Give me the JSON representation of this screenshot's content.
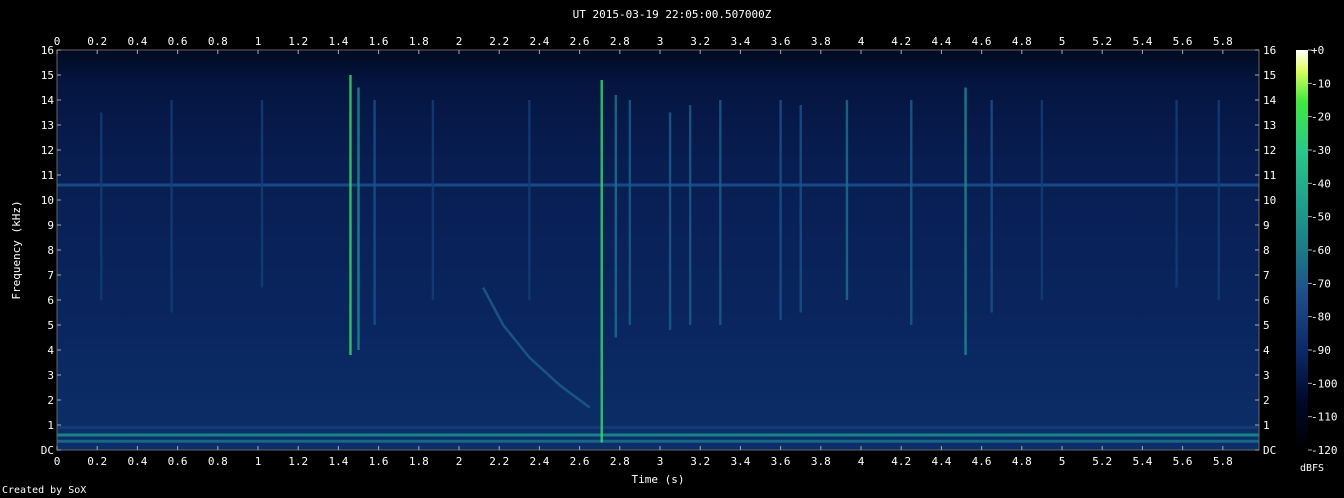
{
  "header": {
    "title": "UT 2015-03-19 22:05:00.507000Z"
  },
  "footer": {
    "credit": "Created by SoX"
  },
  "colorbar": {
    "unit": "dBFS",
    "ticks": [
      "+0",
      "-10",
      "-20",
      "-30",
      "-40",
      "-50",
      "-60",
      "-70",
      "-80",
      "-90",
      "-100",
      "-110",
      "-120"
    ]
  },
  "colors": {
    "background": "#000000",
    "low": "#000828",
    "mid": "#1f4a8a",
    "high": "#29c98a",
    "peak": "#ffffff"
  },
  "chart_data": {
    "type": "heatmap",
    "xlabel": "Time (s)",
    "ylabel": "Frequency (kHz)",
    "xlim": [
      0,
      5.98
    ],
    "ylim": [
      0,
      16
    ],
    "zlim": [
      -120,
      0
    ],
    "x_ticks": [
      "0",
      "0.2",
      "0.4",
      "0.6",
      "0.8",
      "1",
      "1.2",
      "1.4",
      "1.6",
      "1.8",
      "2",
      "2.2",
      "2.4",
      "2.6",
      "2.8",
      "3",
      "3.2",
      "3.4",
      "3.6",
      "3.8",
      "4",
      "4.2",
      "4.4",
      "4.6",
      "4.8",
      "5",
      "5.2",
      "5.4",
      "5.6",
      "5.8"
    ],
    "y_ticks": [
      "DC",
      "1",
      "2",
      "3",
      "4",
      "5",
      "6",
      "7",
      "8",
      "9",
      "10",
      "11",
      "12",
      "13",
      "14",
      "15",
      "16"
    ],
    "background_level_db": -100,
    "tonal_lines": [
      {
        "freq_khz": 10.6,
        "level_db": -80
      },
      {
        "freq_khz": 0.35,
        "level_db": -75
      },
      {
        "freq_khz": 0.6,
        "level_db": -70
      },
      {
        "freq_khz": 0.9,
        "level_db": -85
      }
    ],
    "impulses": [
      {
        "t": 1.46,
        "fmin": 3.8,
        "fmax": 15.0,
        "level_db": -55
      },
      {
        "t": 1.5,
        "fmin": 4.0,
        "fmax": 14.5,
        "level_db": -70
      },
      {
        "t": 1.58,
        "fmin": 5.0,
        "fmax": 14.0,
        "level_db": -80
      },
      {
        "t": 2.71,
        "fmin": 0.3,
        "fmax": 14.8,
        "level_db": -55
      },
      {
        "t": 2.78,
        "fmin": 4.5,
        "fmax": 14.2,
        "level_db": -75
      },
      {
        "t": 2.85,
        "fmin": 5.0,
        "fmax": 14.0,
        "level_db": -78
      },
      {
        "t": 3.05,
        "fmin": 4.8,
        "fmax": 13.5,
        "level_db": -78
      },
      {
        "t": 3.15,
        "fmin": 5.0,
        "fmax": 13.8,
        "level_db": -78
      },
      {
        "t": 3.3,
        "fmin": 5.0,
        "fmax": 14.0,
        "level_db": -78
      },
      {
        "t": 3.6,
        "fmin": 5.2,
        "fmax": 14.0,
        "level_db": -80
      },
      {
        "t": 3.7,
        "fmin": 5.5,
        "fmax": 13.8,
        "level_db": -80
      },
      {
        "t": 3.93,
        "fmin": 6.0,
        "fmax": 14.0,
        "level_db": -75
      },
      {
        "t": 4.25,
        "fmin": 5.0,
        "fmax": 14.0,
        "level_db": -78
      },
      {
        "t": 4.52,
        "fmin": 3.8,
        "fmax": 14.5,
        "level_db": -70
      },
      {
        "t": 4.65,
        "fmin": 5.5,
        "fmax": 14.0,
        "level_db": -80
      },
      {
        "t": 0.22,
        "fmin": 6.0,
        "fmax": 13.5,
        "level_db": -85
      },
      {
        "t": 0.57,
        "fmin": 5.5,
        "fmax": 14.0,
        "level_db": -85
      },
      {
        "t": 1.02,
        "fmin": 6.5,
        "fmax": 14.0,
        "level_db": -85
      },
      {
        "t": 1.87,
        "fmin": 6.0,
        "fmax": 14.0,
        "level_db": -85
      },
      {
        "t": 2.35,
        "fmin": 6.0,
        "fmax": 14.0,
        "level_db": -85
      },
      {
        "t": 4.9,
        "fmin": 6.0,
        "fmax": 14.0,
        "level_db": -85
      },
      {
        "t": 5.57,
        "fmin": 6.5,
        "fmax": 14.0,
        "level_db": -85
      },
      {
        "t": 5.78,
        "fmin": 6.0,
        "fmax": 14.0,
        "level_db": -85
      }
    ],
    "chirp": {
      "t": [
        2.12,
        2.22,
        2.35,
        2.5,
        2.65
      ],
      "f": [
        6.5,
        5.0,
        3.7,
        2.6,
        1.7
      ],
      "level_db": -78
    }
  }
}
